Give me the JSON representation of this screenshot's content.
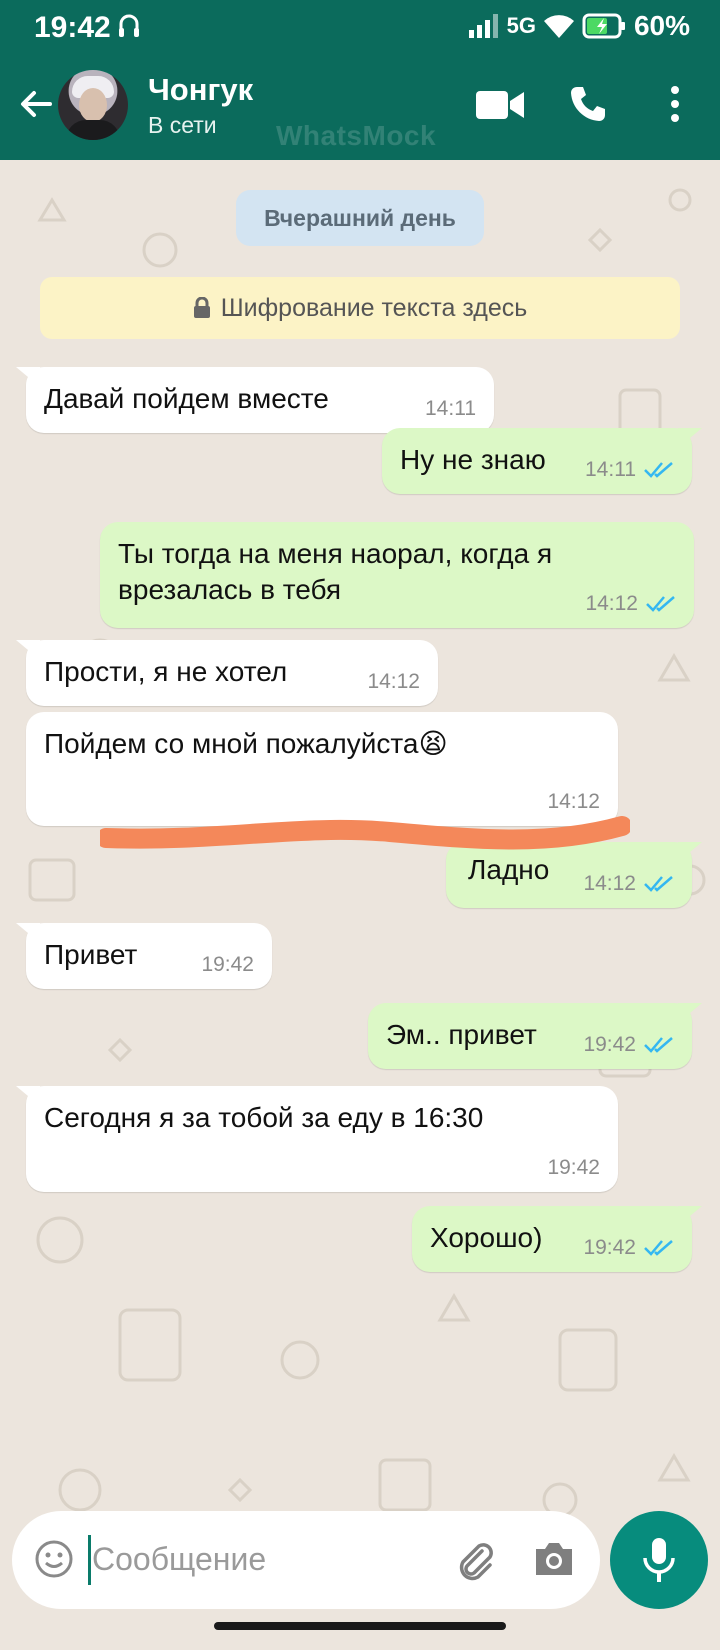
{
  "status_bar": {
    "time": "19:42",
    "network": "5G",
    "battery": "60%"
  },
  "header": {
    "contact_name": "Чонгук",
    "contact_status": "В сети",
    "watermark": "WhatsMock",
    "icons": [
      "back-arrow-icon",
      "video-call-icon",
      "phone-icon",
      "more-vert-icon"
    ]
  },
  "chat": {
    "date_chip": "Вчерашний день",
    "encryption_notice": "Шифрование текста здесь",
    "messages": [
      {
        "dir": "in",
        "text": "Давай пойдем вместе",
        "time": "14:11"
      },
      {
        "dir": "out",
        "text": "Ну не знаю",
        "time": "14:11",
        "read": true
      },
      {
        "dir": "out",
        "text": "Ты тогда на меня наорал, когда я врезалась в тебя",
        "time": "14:12",
        "read": true
      },
      {
        "dir": "in",
        "text": "Прости, я не хотел",
        "time": "14:12"
      },
      {
        "dir": "in",
        "text": "Пойдем со мной пожалуйста",
        "emoji": "😫",
        "time": "14:12"
      },
      {
        "dir": "out",
        "text": "Ладно",
        "time": "14:12",
        "read": true,
        "redacted": true
      },
      {
        "dir": "in",
        "text": "Привет",
        "time": "19:42"
      },
      {
        "dir": "out",
        "text": "Эм.. привет",
        "time": "19:42",
        "read": true
      },
      {
        "dir": "in",
        "text": "Сегодня я за тобой за еду в 16:30",
        "time": "19:42"
      },
      {
        "dir": "out",
        "text": "Хорошо)",
        "time": "19:42",
        "read": true
      }
    ]
  },
  "composer": {
    "placeholder": "Сообщение"
  },
  "colors": {
    "header": "#0b6b5c",
    "chat_background": "#ece5dd",
    "incoming_bubble": "#ffffff",
    "outgoing_bubble": "#dcf8c6",
    "read_ticks": "#34b7f1",
    "mic_button": "#078c7d",
    "redaction": "#f4885a"
  }
}
